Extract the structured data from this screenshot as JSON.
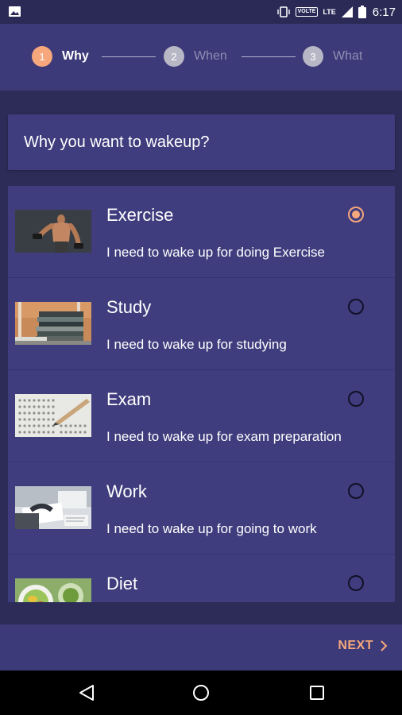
{
  "status_bar": {
    "time": "6:17",
    "volte": "VOLTE",
    "lte": "LTE",
    "icons": [
      "image-icon",
      "vibrate-icon",
      "signal-icon",
      "battery-icon"
    ]
  },
  "stepper": {
    "steps": [
      {
        "number": "1",
        "label": "Why",
        "state": "active"
      },
      {
        "number": "2",
        "label": "When",
        "state": "inactive"
      },
      {
        "number": "3",
        "label": "What",
        "state": "inactive"
      }
    ]
  },
  "question": {
    "text": "Why you want to wakeup?"
  },
  "options": [
    {
      "title": "Exercise",
      "description": "I need to wake up for doing Exercise",
      "selected": true,
      "image": "exercise-photo"
    },
    {
      "title": "Study",
      "description": "I need to wake up for studying",
      "selected": false,
      "image": "books-photo"
    },
    {
      "title": "Exam",
      "description": "I need to wake up for exam preparation",
      "selected": false,
      "image": "answer-sheet-photo"
    },
    {
      "title": "Work",
      "description": "I need to wake up for going to work",
      "selected": false,
      "image": "office-desk-photo"
    },
    {
      "title": "Diet",
      "description": "",
      "selected": false,
      "image": "salad-photo"
    }
  ],
  "footer": {
    "next_label": "NEXT"
  },
  "navigation_bar": {
    "buttons": [
      "back-icon",
      "home-icon",
      "recents-icon"
    ]
  },
  "colors": {
    "background": "#2d2b57",
    "surface": "#3f3d7d",
    "accent": "#f6a77c",
    "inactive_step": "#b8b7c6"
  }
}
